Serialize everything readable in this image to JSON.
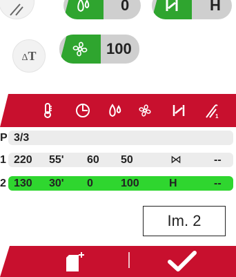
{
  "top": {
    "humidity_value": "0",
    "damper_mode_glyph": "H",
    "fan_value": "100"
  },
  "table": {
    "program_label": "P",
    "program_value": "3/3",
    "rows": [
      {
        "idx": "1",
        "temp": "220",
        "time": "55'",
        "humidity": "60",
        "fan": "50",
        "damper": "⋈",
        "extra": "--"
      },
      {
        "idx": "2",
        "temp": "130",
        "time": "30'",
        "humidity": "0",
        "fan": "100",
        "damper": "H",
        "extra": "--"
      }
    ]
  },
  "annotation": "Im. 2",
  "colors": {
    "accent_red": "#c8102e",
    "accent_green": "#2fa52f",
    "highlight_green": "#2fd62f"
  }
}
